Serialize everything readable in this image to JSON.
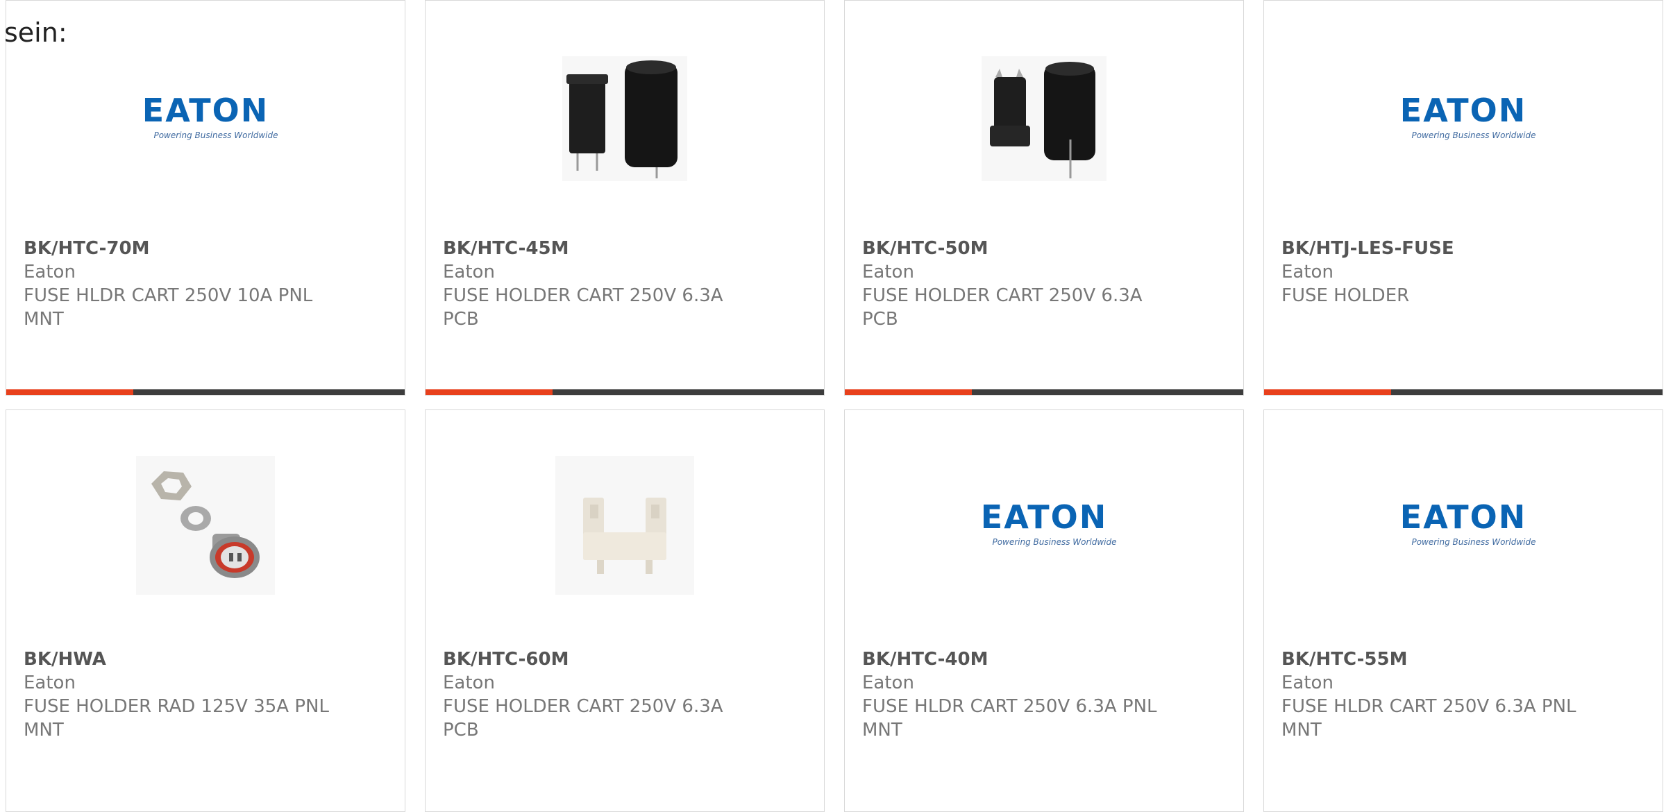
{
  "intro_text": "sein:",
  "colors": {
    "accent": "#e8401c",
    "bar": "#3d3d3d",
    "eaton_blue": "#0a64b4"
  },
  "logo": {
    "brand": "EATON",
    "tagline": "Powering Business Worldwide"
  },
  "products": [
    {
      "part_number": "BK/HTC-70M",
      "manufacturer": "Eaton",
      "description": "FUSE HLDR CART 250V 10A PNL MNT",
      "image": "eaton-logo"
    },
    {
      "part_number": "BK/HTC-45M",
      "manufacturer": "Eaton",
      "description": "FUSE HOLDER CART 250V 6.3A PCB",
      "image": "fuse-holder-cartridge-photo"
    },
    {
      "part_number": "BK/HTC-50M",
      "manufacturer": "Eaton",
      "description": "FUSE HOLDER CART 250V 6.3A PCB",
      "image": "fuse-holder-cartridge-photo"
    },
    {
      "part_number": "BK/HTJ-LES-FUSE",
      "manufacturer": "Eaton",
      "description": "FUSE HOLDER",
      "image": "eaton-logo"
    },
    {
      "part_number": "BK/HWA",
      "manufacturer": "Eaton",
      "description": "FUSE HOLDER RAD 125V 35A PNL MNT",
      "image": "panel-fuse-holder-photo"
    },
    {
      "part_number": "BK/HTC-60M",
      "manufacturer": "Eaton",
      "description": "FUSE HOLDER CART 250V 6.3A PCB",
      "image": "pcb-fuse-clip-photo"
    },
    {
      "part_number": "BK/HTC-40M",
      "manufacturer": "Eaton",
      "description": "FUSE HLDR CART 250V 6.3A PNL MNT",
      "image": "eaton-logo"
    },
    {
      "part_number": "BK/HTC-55M",
      "manufacturer": "Eaton",
      "description": "FUSE HLDR CART 250V 6.3A PNL MNT",
      "image": "eaton-logo"
    }
  ]
}
